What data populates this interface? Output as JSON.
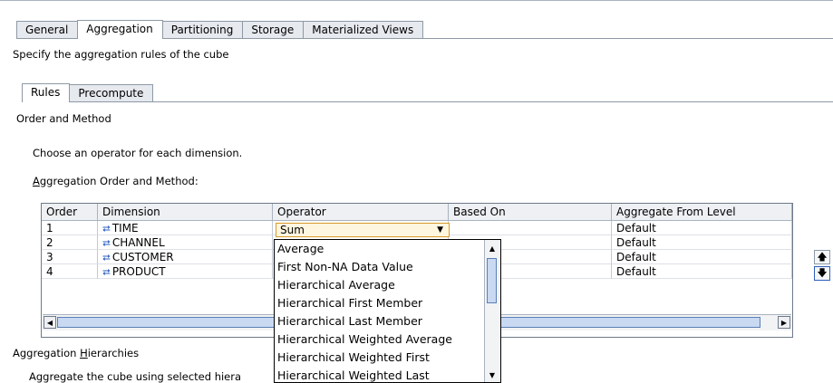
{
  "tabs": [
    {
      "label": "General"
    },
    {
      "label": "Aggregation",
      "active": true
    },
    {
      "label": "Partitioning"
    },
    {
      "label": "Storage"
    },
    {
      "label": "Materialized Views"
    }
  ],
  "description": "Specify the aggregation rules of the cube",
  "subtabs": [
    {
      "label": "Rules",
      "active": true
    },
    {
      "label": "Precompute"
    }
  ],
  "order_method": {
    "section_title": "Order and Method",
    "instruction": "Choose an operator for each dimension.",
    "table_label_mnemonic": "A",
    "table_label_rest": "ggregation Order and Method:"
  },
  "table": {
    "columns": [
      "Order",
      "Dimension",
      "Operator",
      "Based On",
      "Aggregate From Level"
    ],
    "rows": [
      {
        "order": "1",
        "dimension": "TIME",
        "operator": "Sum",
        "based_on": "",
        "level": "Default"
      },
      {
        "order": "2",
        "dimension": "CHANNEL",
        "operator": "",
        "based_on": "",
        "level": "Default"
      },
      {
        "order": "3",
        "dimension": "CUSTOMER",
        "operator": "",
        "based_on": "",
        "level": "Default"
      },
      {
        "order": "4",
        "dimension": "PRODUCT",
        "operator": "",
        "based_on": "",
        "level": "Default"
      }
    ]
  },
  "operator_dropdown": {
    "selected": "Sum",
    "options": [
      "Average",
      "First Non-NA Data Value",
      "Hierarchical Average",
      "Hierarchical First Member",
      "Hierarchical Last Member",
      "Hierarchical Weighted Average",
      "Hierarchical Weighted First",
      "Hierarchical Weighted Last"
    ]
  },
  "hierarchies": {
    "title_prefix": "Aggregation ",
    "title_mnemonic": "H",
    "title_rest": "ierarchies",
    "instruction": "Aggregate the cube using selected hiera"
  },
  "icons": {
    "dimension": "dimension-icon",
    "move_up": "arrow-up-icon",
    "move_down": "arrow-down-icon"
  },
  "colors": {
    "accent_border": "#d79a2b",
    "selection": "#c9d9f2",
    "icon_blue": "#2d5fbf"
  }
}
